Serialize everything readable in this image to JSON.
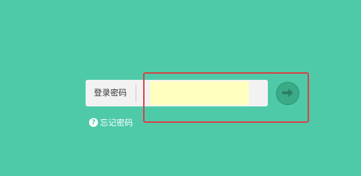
{
  "login": {
    "password_label": "登录密码",
    "password_value": "",
    "forgot_password": "忘记密码"
  },
  "icons": {
    "submit": "arrow-right-icon",
    "help": "question-circle-icon",
    "help_glyph": "?"
  },
  "colors": {
    "background": "#4ecaa9",
    "panel": "#f2f2f2",
    "input_fill": "#ffffc0",
    "submit_button": "#3aaa87",
    "highlight": "#e0393f"
  }
}
